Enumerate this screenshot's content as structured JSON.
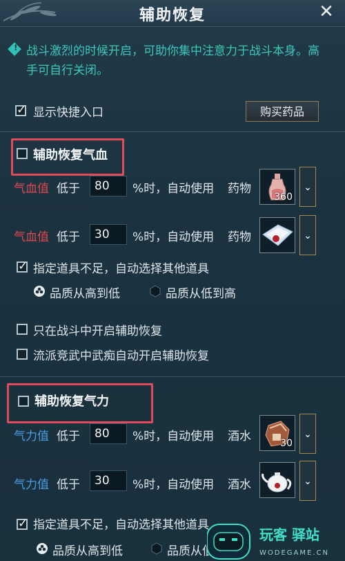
{
  "window": {
    "title": "辅助恢复",
    "close": "✕"
  },
  "tip": "战斗激烈的时候开启，可助你集中注意力于战斗本身。高手可自行关闭。",
  "show_shortcut": {
    "label": "显示快捷入口",
    "checked": true
  },
  "buy_button": "购买药品",
  "hp_section": {
    "title": "辅助恢复气血",
    "enabled": false,
    "rows": [
      {
        "stat": "气血值",
        "below": "低于",
        "value": "80",
        "suffix": "%时，自动使用",
        "item_type": "药物",
        "qty": "360",
        "icon": "potion-bottle-icon"
      },
      {
        "stat": "气血值",
        "below": "低于",
        "value": "30",
        "suffix": "%时，自动使用",
        "item_type": "药物",
        "qty": "",
        "icon": "medicine-packet-icon"
      }
    ],
    "auto_select": {
      "label": "指定道具不足，自动选择其他道具",
      "checked": true
    },
    "quality_high_low": "品质从高到低",
    "quality_low_high": "品质从低到高",
    "only_in_battle": {
      "label": "只在战斗中开启辅助恢复",
      "checked": false
    },
    "school_arena": {
      "label": "流派竞武中武痴自动开启辅助恢复",
      "checked": false
    }
  },
  "mp_section": {
    "title": "辅助恢复气力",
    "enabled": false,
    "rows": [
      {
        "stat": "气力值",
        "below": "低于",
        "value": "80",
        "suffix": "%时，自动使用",
        "item_type": "酒水",
        "qty": "30",
        "icon": "wine-jar-icon"
      },
      {
        "stat": "气力值",
        "below": "低于",
        "value": "30",
        "suffix": "%时，自动使用",
        "item_type": "酒水",
        "qty": "",
        "icon": "teapot-icon"
      }
    ],
    "auto_select": {
      "label": "指定道具不足，自动选择其他道具",
      "checked": true
    },
    "quality_high_low": "品质从高到低",
    "quality_low_high": "品质从低到高"
  },
  "watermark": {
    "brand": "玩客 驿站",
    "site": "WODEGAME.CN"
  },
  "colors": {
    "hp_stat": "#e0474e",
    "mp_stat": "#4b9de3",
    "tip": "#3cc7b8",
    "highlight_box": "#e24b5b"
  }
}
